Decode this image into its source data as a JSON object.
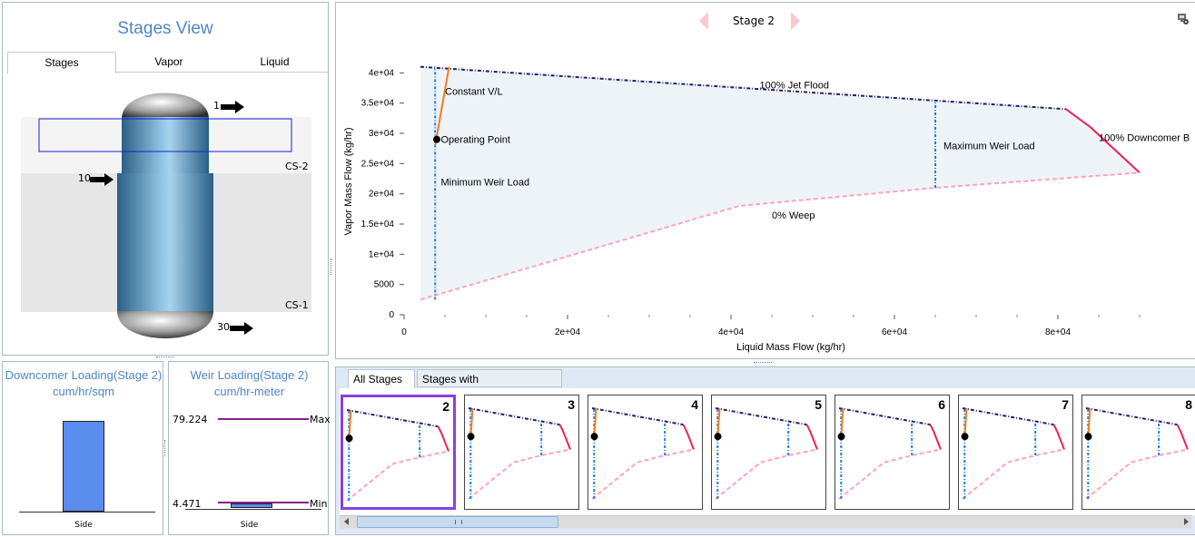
{
  "stages_view": {
    "title": "Stages View",
    "tabs": [
      "Stages",
      "Vapor",
      "Liquid"
    ],
    "active_tab": "Stages",
    "column": {
      "feed_labels": [
        "1",
        "10",
        "30"
      ],
      "section_labels": [
        "CS-2",
        "CS-1"
      ]
    }
  },
  "downcomer": {
    "title": "Downcomer Loading(Stage 2)",
    "unit": "cum/hr/sqm",
    "bar_label": "Side",
    "fill_color": "#5b8def"
  },
  "weir": {
    "title": "Weir Loading(Stage 2)",
    "unit": "cum/hr-meter",
    "max_value": "79.224",
    "max_label": "Max",
    "min_value": "4.471",
    "min_label": "Min",
    "bar_label": "Side",
    "line_color": "#8b1c8c"
  },
  "stage_nav": {
    "current": "Stage 2"
  },
  "chart_data": {
    "type": "line",
    "xlabel": "Liquid Mass Flow (kg/hr)",
    "ylabel": "Vapor Mass Flow (kg/hr)",
    "xlim": [
      0,
      96000
    ],
    "ylim": [
      0,
      42000
    ],
    "x_ticks": [
      {
        "v": 0,
        "label": "0"
      },
      {
        "v": 20000,
        "label": "2e+04"
      },
      {
        "v": 40000,
        "label": "4e+04"
      },
      {
        "v": 60000,
        "label": "6e+04"
      },
      {
        "v": 80000,
        "label": "8e+04"
      }
    ],
    "y_ticks": [
      {
        "v": 0,
        "label": "0"
      },
      {
        "v": 5000,
        "label": "5000"
      },
      {
        "v": 10000,
        "label": "1e+04"
      },
      {
        "v": 15000,
        "label": "1.5e+04"
      },
      {
        "v": 20000,
        "label": "2e+04"
      },
      {
        "v": 25000,
        "label": "2.5e+04"
      },
      {
        "v": 30000,
        "label": "3e+04"
      },
      {
        "v": 35000,
        "label": "3.5e+04"
      },
      {
        "v": 40000,
        "label": "4e+04"
      }
    ],
    "series": [
      {
        "name": "100% Jet Flood",
        "color": "#1f1f6e",
        "style": "dashdot",
        "points": [
          [
            2000,
            41000
          ],
          [
            81000,
            34000
          ]
        ]
      },
      {
        "name": "100% Downcomer B",
        "color": "#f0205a",
        "style": "solid",
        "points": [
          [
            81000,
            34000
          ],
          [
            84000,
            31000
          ],
          [
            90000,
            23500
          ]
        ]
      },
      {
        "name": "0% Weep",
        "color": "#ffa3bf",
        "style": "dashed",
        "points": [
          [
            2000,
            2500
          ],
          [
            41000,
            18000
          ],
          [
            65000,
            21000
          ],
          [
            90000,
            23500
          ]
        ]
      },
      {
        "name": "Minimum Weir Load",
        "color": "#1a7ee6",
        "style": "dotdash",
        "points": [
          [
            3800,
            2500
          ],
          [
            3800,
            41000
          ]
        ]
      },
      {
        "name": "Maximum Weir Load",
        "color": "#1a7ee6",
        "style": "dotdash",
        "points": [
          [
            65000,
            21000
          ],
          [
            65000,
            35300
          ]
        ]
      },
      {
        "name": "Constant V/L",
        "color": "#f07f1a",
        "style": "solid",
        "points": [
          [
            3800,
            28000
          ],
          [
            5500,
            41000
          ]
        ]
      }
    ],
    "operating_point": {
      "label": "Operating Point",
      "x": 4000,
      "y": 29000
    },
    "annotations": [
      {
        "text": "Constant V/L",
        "x": 5000,
        "y": 37000
      },
      {
        "text": "100% Jet Flood",
        "x": 43500,
        "y": 38000
      },
      {
        "text": "Operating Point",
        "x": 4500,
        "y": 29000
      },
      {
        "text": "Maximum Weir Load",
        "x": 66000,
        "y": 28000
      },
      {
        "text": "100% Downcomer B",
        "x": 85000,
        "y": 29300
      },
      {
        "text": "Minimum Weir Load",
        "x": 4500,
        "y": 22000
      },
      {
        "text": "0% Weep",
        "x": 45000,
        "y": 16500
      }
    ]
  },
  "bottom_tabs": [
    "All Stages",
    "Stages with Errors/Warnings"
  ],
  "thumbnails": [
    "2",
    "3",
    "4",
    "5",
    "6",
    "7",
    "8"
  ],
  "selected_thumbnail": "2",
  "icons": {
    "nav_left": "left-triangle-icon",
    "nav_right": "right-triangle-icon",
    "corner": "settings-icon"
  }
}
